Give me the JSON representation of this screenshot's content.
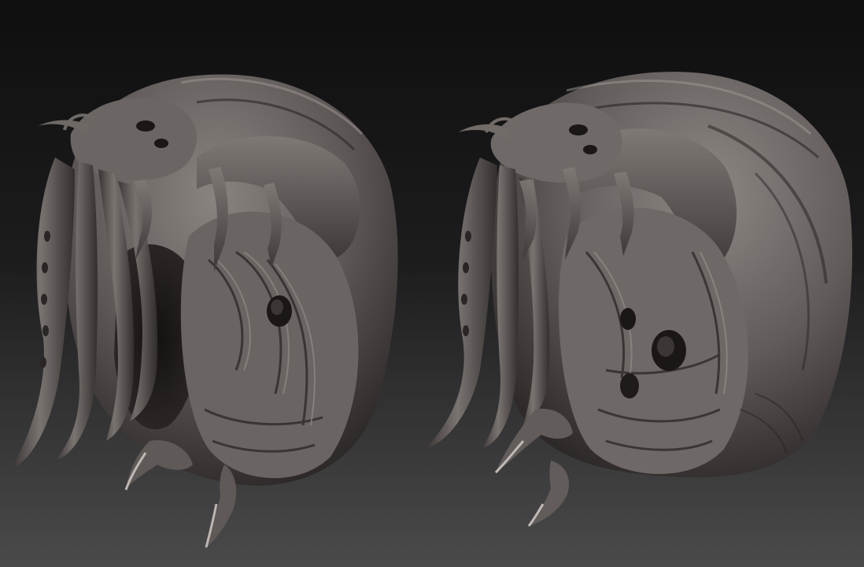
{
  "scene": {
    "kind": "sculpt-render",
    "views": [
      {
        "id": "view-left",
        "angle": "three-quarter"
      },
      {
        "id": "view-right",
        "angle": "side"
      }
    ]
  },
  "colors": {
    "background_top": "#0f0f10",
    "background_bottom": "#4a4a4b",
    "clay_light": "#8a8481",
    "clay_mid": "#5d5756",
    "clay_dark": "#2b2726",
    "crevice": "#1a1716"
  }
}
